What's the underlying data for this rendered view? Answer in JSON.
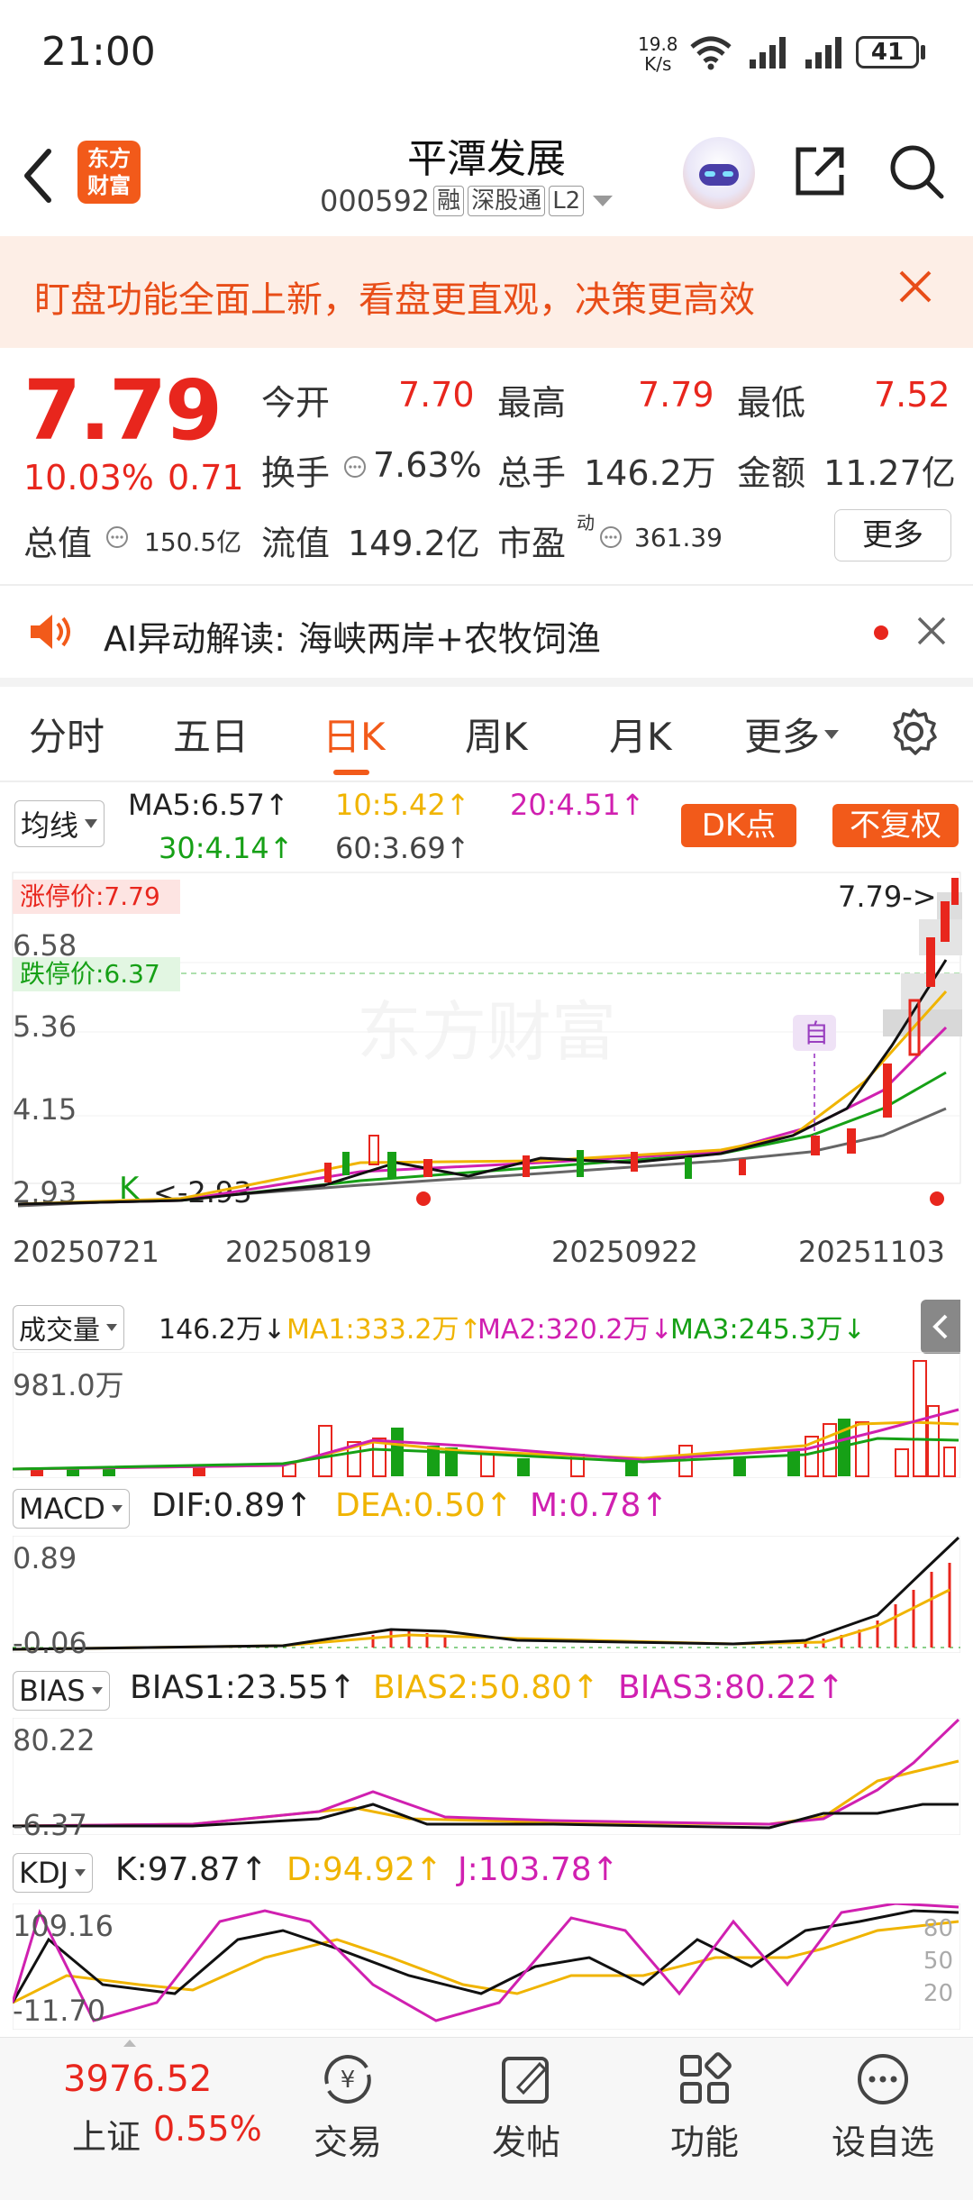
{
  "status_bar": {
    "time": "21:00",
    "net_speed_value": "19.8",
    "net_speed_unit": "K/s",
    "battery": "41"
  },
  "header": {
    "logo_line1": "东方",
    "logo_line2": "财富",
    "stock_name": "平潭发展",
    "stock_code": "000592",
    "tags": [
      "融",
      "深股通",
      "L2"
    ]
  },
  "banner": {
    "text": "盯盘功能全面上新，看盘更直观，决策更高效"
  },
  "quote": {
    "price": "7.79",
    "change_pct": "10.03%",
    "change": "0.71",
    "open_label": "今开",
    "open": "7.70",
    "high_label": "最高",
    "high": "7.79",
    "low_label": "最低",
    "low": "7.52",
    "turnover_label": "换手",
    "turnover": "7.63%",
    "volume_label": "总手",
    "volume": "146.2万",
    "amount_label": "金额",
    "amount": "11.27亿",
    "market_cap_label": "总值",
    "market_cap": "150.5亿",
    "float_cap_label": "流值",
    "float_cap": "149.2亿",
    "pe_label": "市盈",
    "pe_sup": "动",
    "pe": "361.39",
    "more": "更多"
  },
  "ai_bar": {
    "label": "AI异动解读:",
    "text": "海峡两岸+农牧饲渔"
  },
  "tabs": [
    "分时",
    "五日",
    "日K",
    "周K",
    "月K",
    "更多"
  ],
  "active_tab": "日K",
  "ma": {
    "selector": "均线",
    "ma5": "MA5:6.57↑",
    "ma10": "10:5.42↑",
    "ma20": "20:4.51↑",
    "ma30": "30:4.14↑",
    "ma60": "60:3.69↑",
    "dk_button": "DK点",
    "fq_button": "不复权"
  },
  "kline": {
    "limit_up_label": "涨停价:7.79",
    "limit_down_label": "跌停价:6.37",
    "y_labels": [
      "6.58",
      "5.36",
      "4.15",
      "2.93"
    ],
    "max_marker": "7.79->",
    "min_marker": "<-2.93",
    "x_labels": [
      "20250721",
      "20250819",
      "20250922",
      "20251103"
    ],
    "self_marker": "自",
    "watermark": "东方财富"
  },
  "volume": {
    "selector": "成交量",
    "value": "146.2万↓",
    "ma1": "MA1:333.2万↑",
    "ma2": "MA2:320.2万↓",
    "ma3": "MA3:245.3万↓",
    "y_max": "981.0万"
  },
  "macd": {
    "selector": "MACD",
    "dif": "DIF:0.89↑",
    "dea": "DEA:0.50↑",
    "m": "M:0.78↑",
    "y_top": "0.89",
    "y_bottom": "-0.06"
  },
  "bias": {
    "selector": "BIAS",
    "b1": "BIAS1:23.55↑",
    "b2": "BIAS2:50.80↑",
    "b3": "BIAS3:80.22↑",
    "y_top": "80.22",
    "y_bottom": "-6.37"
  },
  "kdj": {
    "selector": "KDJ",
    "k": "K:97.87↑",
    "d": "D:94.92↑",
    "j": "J:103.78↑",
    "y_top": "109.16",
    "y_bottom": "-11.70",
    "levels": [
      "80",
      "50",
      "20"
    ]
  },
  "bottom_nav": {
    "index_value": "3976.52",
    "index_name": "上证",
    "index_pct": "0.55%",
    "items": [
      "交易",
      "发帖",
      "功能",
      "设自选"
    ]
  },
  "colors": {
    "up": "#e8261d",
    "down": "#16a016",
    "accent": "#f25a1a",
    "ma10": "#f0b400",
    "ma20": "#d020b0"
  }
}
